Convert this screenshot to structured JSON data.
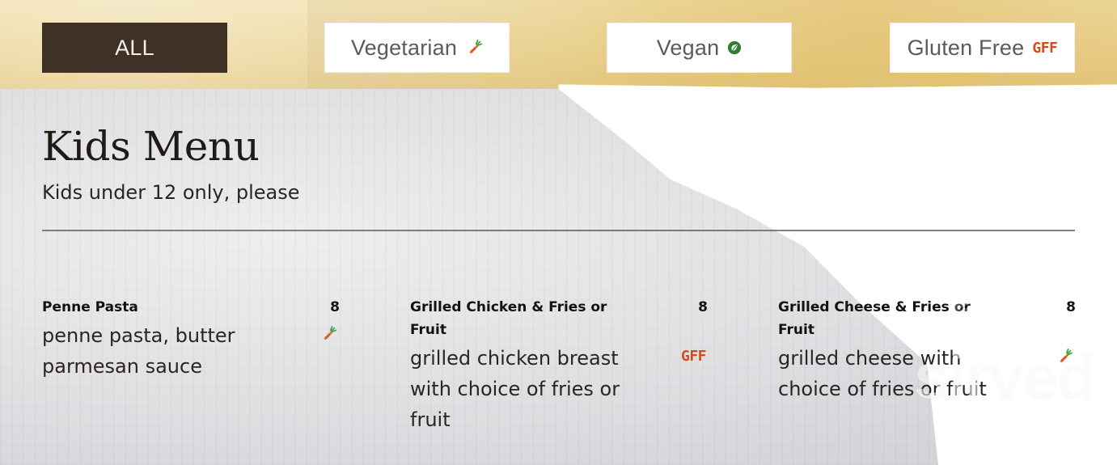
{
  "filters": {
    "all_label": "ALL",
    "vegetarian_label": "Vegetarian",
    "vegan_label": "Vegan",
    "gluten_free_label": "Gluten Free",
    "gluten_free_badge": "GFF",
    "vegetarian_icon": "carrot-icon",
    "vegan_icon": "vegan-leaf-icon"
  },
  "section": {
    "title": "Kids Menu",
    "subtitle": "Kids under 12 only, please"
  },
  "items": [
    {
      "name": "Penne Pasta",
      "price": "8",
      "description": "penne pasta, butter parmesan sauce",
      "tag": "carrot-icon"
    },
    {
      "name": "Grilled Chicken & Fries or Fruit",
      "price": "8",
      "description": "grilled chicken breast with choice of fries or fruit",
      "tag": "GFF"
    },
    {
      "name": "Grilled Cheese & Fries or Fruit",
      "price": "8",
      "description": "grilled cheese with choice of fries or fruit",
      "tag": "carrot-icon"
    }
  ],
  "colors": {
    "active_filter_bg": "#3f3126",
    "gff_orange": "#d34b1c",
    "vegan_green": "#2f7d32",
    "carrot_orange": "#e5672b",
    "carrot_green": "#4aa34a"
  },
  "watermark": {
    "text": "sirved"
  }
}
